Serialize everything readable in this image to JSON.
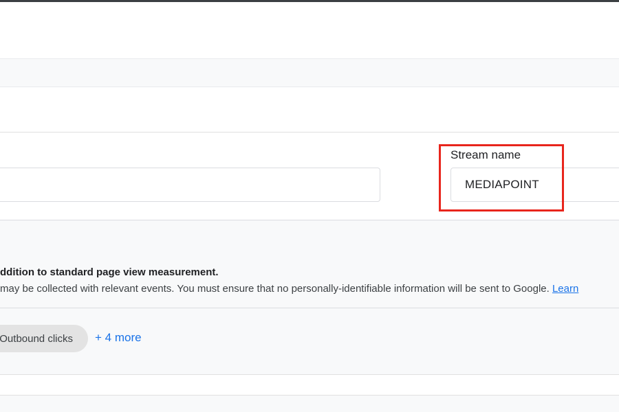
{
  "stream": {
    "label": "Stream name",
    "value": "MEDIAPOINT"
  },
  "enhanced_measurement": {
    "heading": "ddition to standard page view measurement.",
    "description": "may be collected with relevant events. You must ensure that no personally-identifiable information will be sent to Google.",
    "learn_more": "Learn",
    "chip_label": "Outbound clicks",
    "more_label": "+ 4 more"
  },
  "colors": {
    "highlight": "#e8251c",
    "link": "#1a73e8"
  }
}
